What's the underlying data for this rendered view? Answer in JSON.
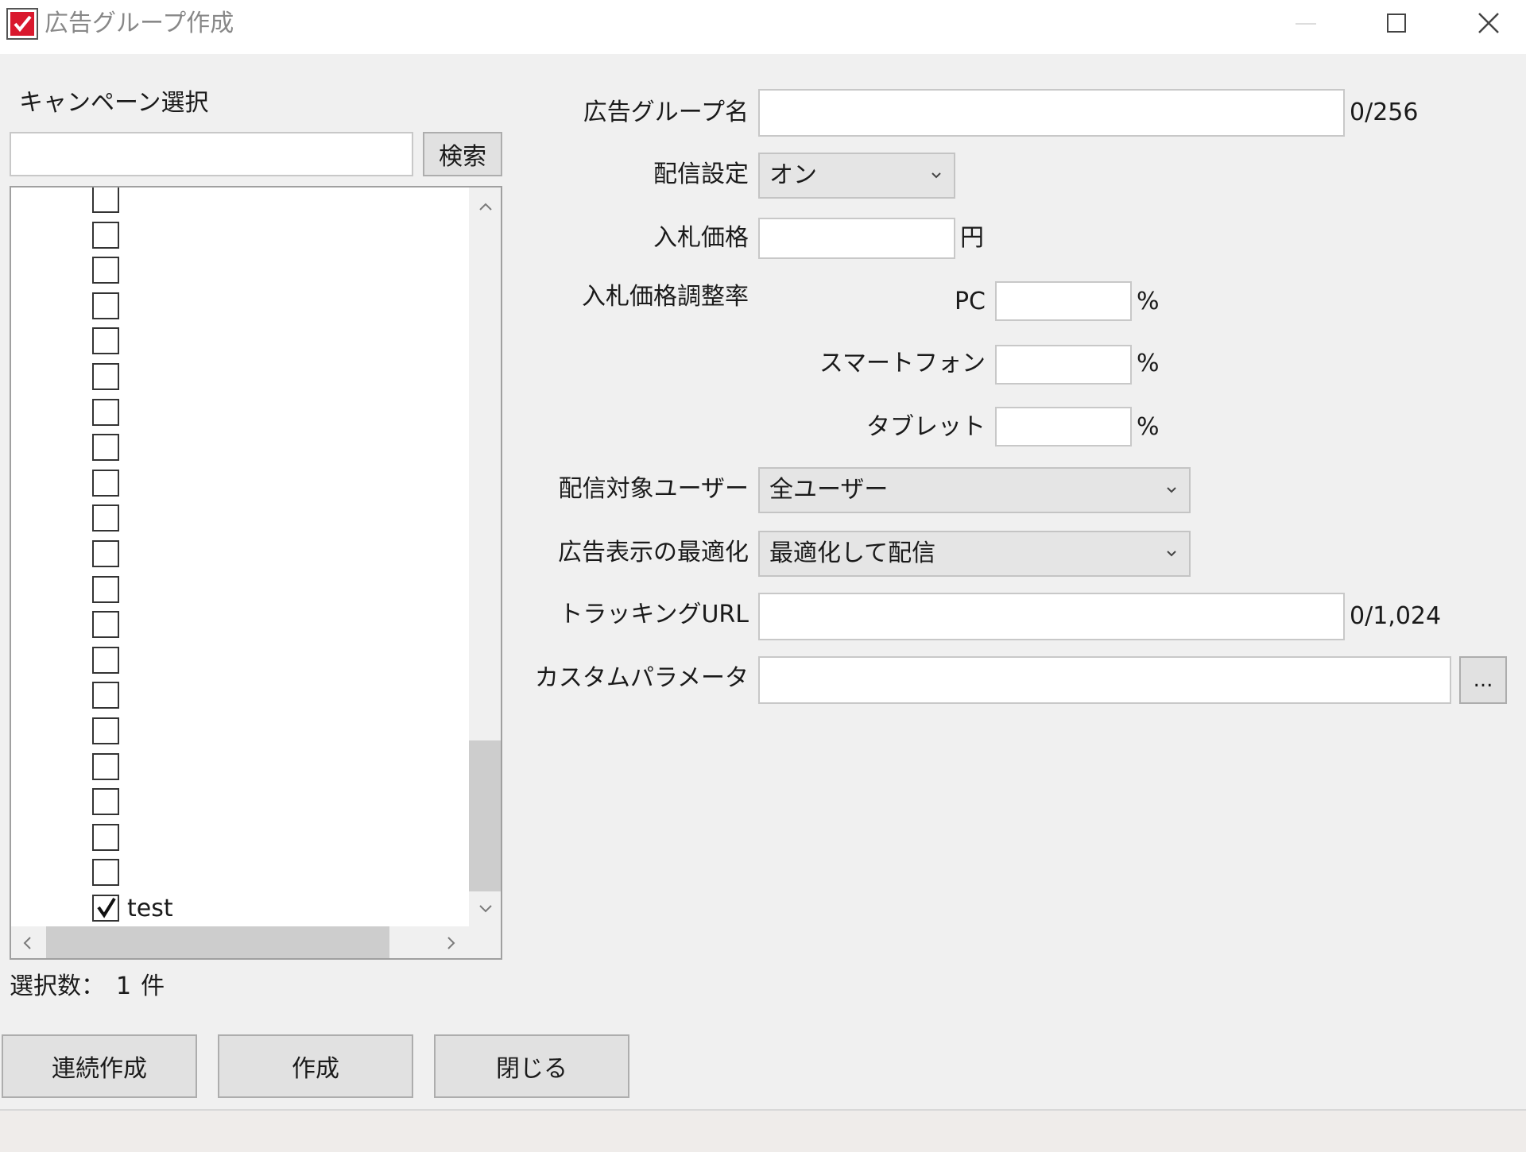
{
  "window": {
    "title": "広告グループ作成"
  },
  "campaign_panel": {
    "heading": "キャンペーン選択",
    "search_value": "",
    "search_button": "検索",
    "items": [
      {
        "label": "",
        "checked": false
      },
      {
        "label": "",
        "checked": false
      },
      {
        "label": "",
        "checked": false
      },
      {
        "label": "",
        "checked": false
      },
      {
        "label": "",
        "checked": false
      },
      {
        "label": "",
        "checked": false
      },
      {
        "label": "",
        "checked": false
      },
      {
        "label": "",
        "checked": false
      },
      {
        "label": "",
        "checked": false
      },
      {
        "label": "",
        "checked": false
      },
      {
        "label": "",
        "checked": false
      },
      {
        "label": "",
        "checked": false
      },
      {
        "label": "",
        "checked": false
      },
      {
        "label": "",
        "checked": false
      },
      {
        "label": "",
        "checked": false
      },
      {
        "label": "",
        "checked": false
      },
      {
        "label": "",
        "checked": false
      },
      {
        "label": "",
        "checked": false
      },
      {
        "label": "",
        "checked": false
      },
      {
        "label": "",
        "checked": false
      },
      {
        "label": "test",
        "checked": true
      }
    ],
    "selection_label": "選択数：",
    "selection_count": "1",
    "selection_unit": "件"
  },
  "form": {
    "ad_group_name": {
      "label": "広告グループ名",
      "value": "",
      "counter": "0/256"
    },
    "delivery": {
      "label": "配信設定",
      "value": "オン"
    },
    "bid": {
      "label": "入札価格",
      "value": "",
      "unit": "円"
    },
    "bid_adjust": {
      "label": "入札価格調整率",
      "pc": {
        "label": "PC",
        "value": "",
        "unit": "%"
      },
      "smartphone": {
        "label": "スマートフォン",
        "value": "",
        "unit": "%"
      },
      "tablet": {
        "label": "タブレット",
        "value": "",
        "unit": "%"
      }
    },
    "target_users": {
      "label": "配信対象ユーザー",
      "value": "全ユーザー"
    },
    "ad_optimization": {
      "label": "広告表示の最適化",
      "value": "最適化して配信"
    },
    "tracking_url": {
      "label": "トラッキングURL",
      "value": "",
      "counter": "0/1,024"
    },
    "custom_params": {
      "label": "カスタムパラメータ",
      "value": "",
      "button": "..."
    }
  },
  "buttons": {
    "continuous_create": "連続作成",
    "create": "作成",
    "close": "閉じる"
  },
  "colors": {
    "window_bg": "#f0f0f0",
    "icon_red": "#d9182d"
  }
}
